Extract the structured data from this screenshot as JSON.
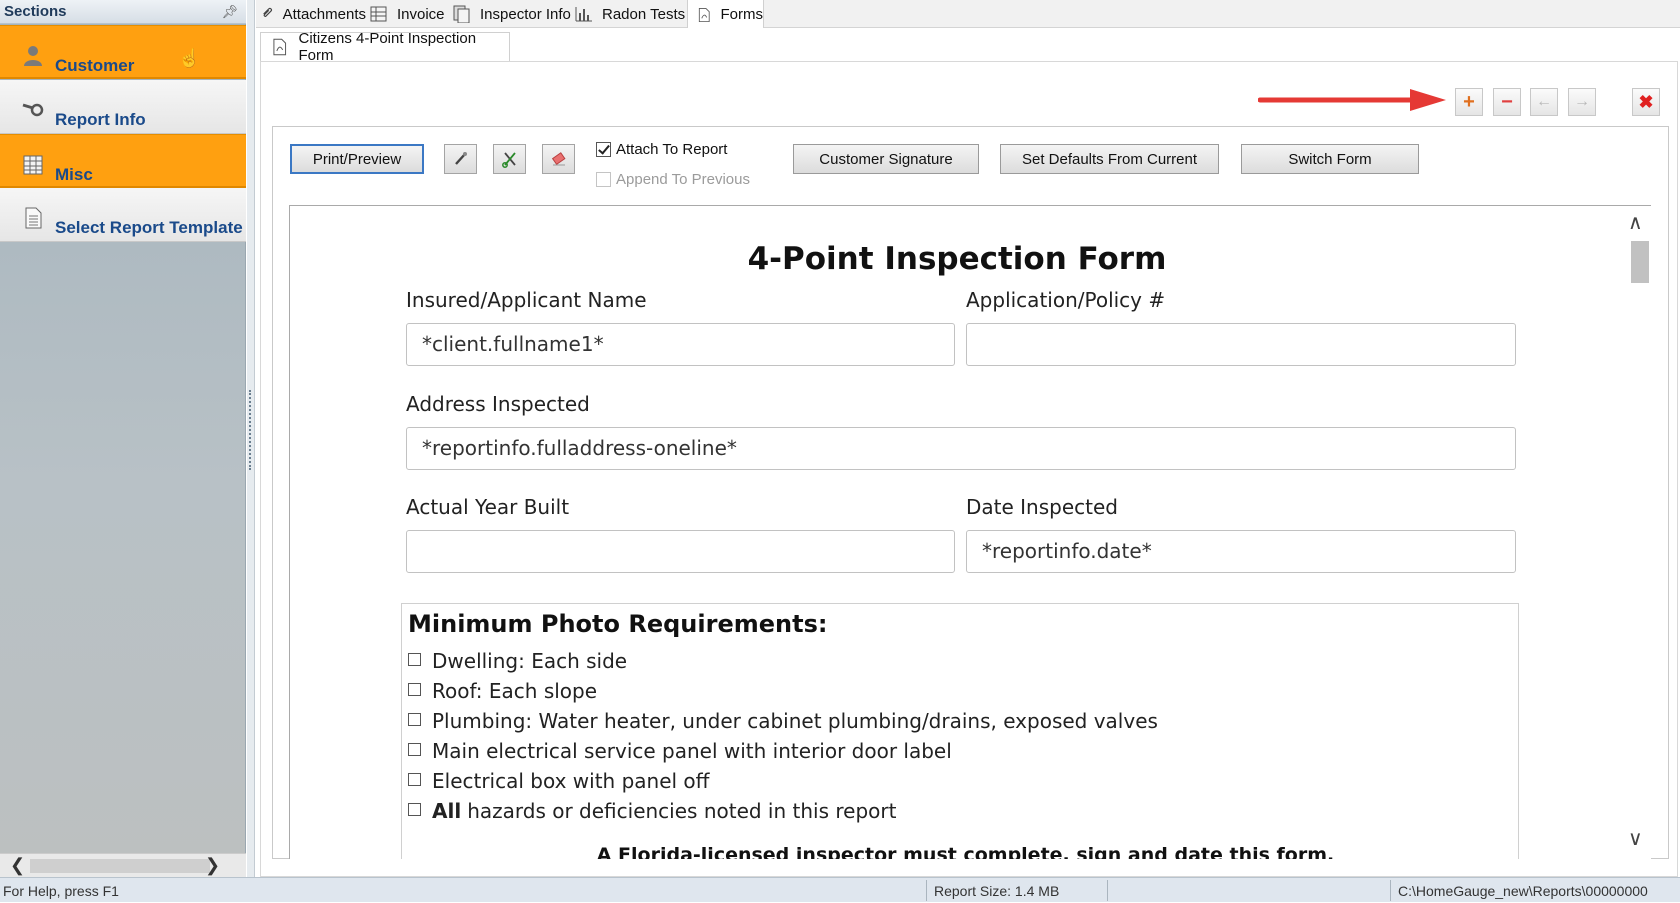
{
  "sidebar": {
    "title": "Sections",
    "pin_icon": "pin-icon",
    "items": [
      {
        "label": "Customer",
        "icon": "person-icon",
        "state": "active"
      },
      {
        "label": "Report Info",
        "icon": "key-icon",
        "state": "plain"
      },
      {
        "label": "Misc",
        "icon": "table-icon",
        "state": "active"
      },
      {
        "label": "Select Report Template",
        "icon": "document-icon",
        "state": "plain"
      }
    ]
  },
  "tabs": [
    {
      "label": "Attachments",
      "icon": "paperclip-icon"
    },
    {
      "label": "Invoice",
      "icon": "invoice-grid-icon"
    },
    {
      "label": "Inspector Info",
      "icon": "id-card-icon"
    },
    {
      "label": "Radon Tests",
      "icon": "bar-chart-icon"
    },
    {
      "label": "Forms",
      "icon": "pdf-file-icon",
      "selected": true
    }
  ],
  "subtab": {
    "label": "Citizens 4-Point Inspection Form",
    "icon": "pdf-file-icon"
  },
  "form_toolbar": {
    "add_icon": "plus-icon",
    "remove_icon": "minus-icon",
    "prev_icon": "arrow-left-icon",
    "next_icon": "arrow-right-icon",
    "close_icon": "close-icon",
    "highlight_color": "#e53935"
  },
  "actions": {
    "print_preview": "Print/Preview",
    "tool_icons": [
      "pencil-tool-icon",
      "scissors-tool-icon",
      "eraser-icon"
    ],
    "attach_to_report": {
      "label": "Attach To Report",
      "checked": true
    },
    "append_to_previous": {
      "label": "Append To Previous",
      "checked": false,
      "disabled": true
    },
    "customer_signature": "Customer Signature",
    "set_defaults": "Set Defaults From Current",
    "switch_form": "Switch Form"
  },
  "document": {
    "title": "4-Point Inspection Form",
    "fields": {
      "insured_label": "Insured/Applicant Name",
      "insured_value": "*client.fullname1*",
      "policy_label": "Application/Policy #",
      "policy_value": "",
      "address_label": "Address Inspected",
      "address_value": "*reportinfo.fulladdress-oneline*",
      "year_label": "Actual Year Built",
      "year_value": "",
      "date_label": "Date Inspected",
      "date_value": "*reportinfo.date*"
    },
    "photo_heading": "Minimum Photo Requirements:",
    "photo_requirements": [
      {
        "bold": "",
        "text": "Dwelling: Each side"
      },
      {
        "bold": "",
        "text": "Roof: Each slope"
      },
      {
        "bold": "",
        "text": "Plumbing: Water heater, under cabinet plumbing/drains, exposed valves"
      },
      {
        "bold": "",
        "text": "Main electrical service panel with interior door label"
      },
      {
        "bold": "",
        "text": "Electrical box with panel off"
      },
      {
        "bold": "All",
        "text": "hazards or deficiencies noted in this report"
      }
    ],
    "notice": "A Florida-licensed inspector must complete, sign and date this form."
  },
  "status": {
    "help": "For Help, press F1",
    "report_size": "Report Size: 1.4 MB",
    "path": "C:\\HomeGauge_new\\Reports\\00000000"
  }
}
